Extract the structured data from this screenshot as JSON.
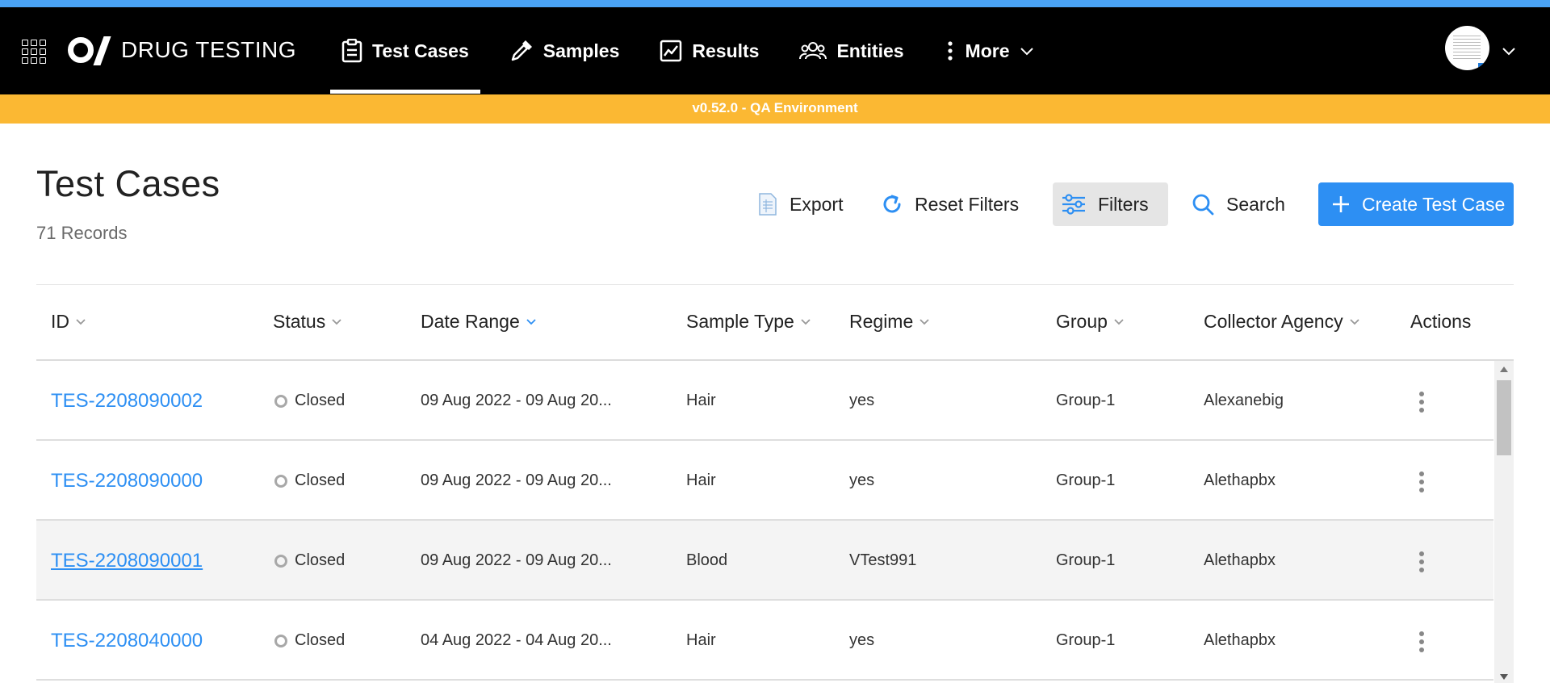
{
  "app": {
    "title": "DRUG TESTING",
    "env_label": "v0.52.0 - QA Environment",
    "colors": {
      "accent": "#2d8ff3",
      "topbar": "#000000",
      "env_bar": "#fbb833",
      "top_strip": "#4aa3f5"
    }
  },
  "nav": {
    "items": [
      {
        "label": "Test Cases",
        "icon": "clipboard-icon",
        "active": true
      },
      {
        "label": "Samples",
        "icon": "dropper-icon",
        "active": false
      },
      {
        "label": "Results",
        "icon": "chart-icon",
        "active": false
      },
      {
        "label": "Entities",
        "icon": "users-icon",
        "active": false
      },
      {
        "label": "More",
        "icon": "kebab-icon",
        "active": false
      }
    ]
  },
  "page": {
    "title": "Test Cases",
    "records": "71 Records"
  },
  "toolbar": {
    "export": "Export",
    "reset_filters": "Reset Filters",
    "filters": "Filters",
    "search": "Search",
    "create": "Create Test Case"
  },
  "table": {
    "columns": [
      "ID",
      "Status",
      "Date Range",
      "Sample Type",
      "Regime",
      "Group",
      "Collector Agency",
      "Actions"
    ],
    "sorted_column": "Date Range",
    "rows": [
      {
        "id": "TES-2208090002",
        "status": "Closed",
        "date_range": "09 Aug 2022 - 09 Aug 20...",
        "sample_type": "Hair",
        "regime": "yes",
        "group": "Group-1",
        "collector_agency": "Alexanebig"
      },
      {
        "id": "TES-2208090000",
        "status": "Closed",
        "date_range": "09 Aug 2022 - 09 Aug 20...",
        "sample_type": "Hair",
        "regime": "yes",
        "group": "Group-1",
        "collector_agency": "Alethapbx"
      },
      {
        "id": "TES-2208090001",
        "status": "Closed",
        "date_range": "09 Aug 2022 - 09 Aug 20...",
        "sample_type": "Blood",
        "regime": "VTest991",
        "group": "Group-1",
        "collector_agency": "Alethapbx"
      },
      {
        "id": "TES-2208040000",
        "status": "Closed",
        "date_range": "04 Aug 2022 - 04 Aug 20...",
        "sample_type": "Hair",
        "regime": "yes",
        "group": "Group-1",
        "collector_agency": "Alethapbx"
      }
    ]
  }
}
